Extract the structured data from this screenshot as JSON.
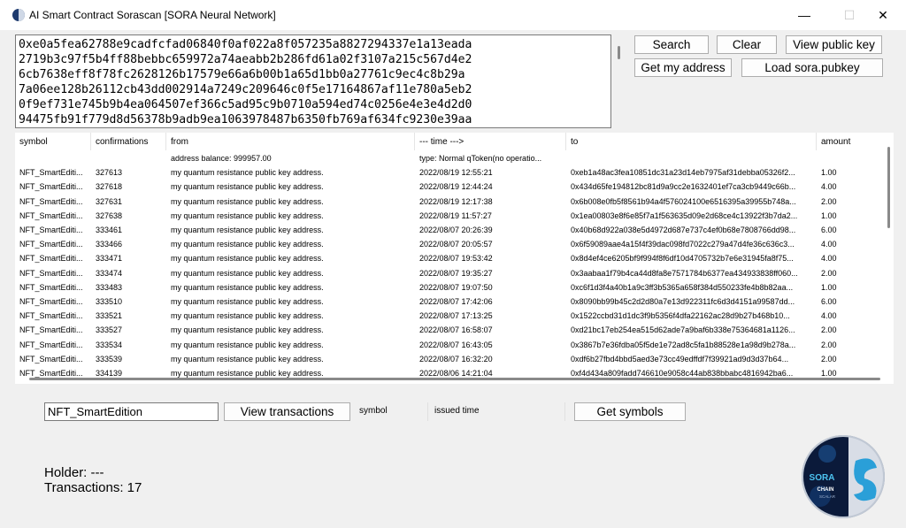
{
  "window": {
    "title": "AI Smart Contract Sorascan [SORA Neural Network]",
    "minimize": "—",
    "maximize": "☐",
    "close": "✕"
  },
  "address_text": "0xe0a5fea62788e9cadfcfad06840f0af022a8f057235a8827294337e1a13eada\n2719b3c97f5b4ff88bebbc659972a74aeabb2b286fd61a02f3107a215c567d4e2\n6cb7638eff8f78fc2628126b17579e66a6b00b1a65d1bb0a27761c9ec4c8b29a\n7a06ee128b26112cb43dd002914a7249c209646c0f5e17164867af11e780a5eb2\n0f9ef731e745b9b4ea064507ef366c5ad95c9b0710a594ed74c0256e4e3e4d2d0\n94475fb91f779d8d56378b9adb9ea1063978487b6350fb769af634fc9230e39aa",
  "buttons": {
    "search": "Search",
    "clear": "Clear",
    "view_public_key": "View public key",
    "get_my_address": "Get my address",
    "load_pubkey": "Load sora.pubkey",
    "view_transactions": "View transactions",
    "get_symbols": "Get symbols"
  },
  "table": {
    "columns": [
      "symbol",
      "confirmations",
      "from",
      "--- time --->",
      "to",
      "amount"
    ],
    "info_row": {
      "from": "address balance: 999957.00",
      "time": "type: Normal qToken(no operatio..."
    },
    "rows": [
      {
        "symbol": "NFT_SmartEditi...",
        "confirmations": "327613",
        "from": "my quantum resistance public key address.",
        "time": "2022/08/19 12:55:21",
        "to": "0xeb1a48ac3fea10851dc31a23d14eb7975af31debba05326f2...",
        "amount": "1.00"
      },
      {
        "symbol": "NFT_SmartEditi...",
        "confirmations": "327618",
        "from": "my quantum resistance public key address.",
        "time": "2022/08/19 12:44:24",
        "to": "0x434d65fe194812bc81d9a9cc2e1632401ef7ca3cb9449c66b...",
        "amount": "4.00"
      },
      {
        "symbol": "NFT_SmartEditi...",
        "confirmations": "327631",
        "from": "my quantum resistance public key address.",
        "time": "2022/08/19 12:17:38",
        "to": "0x6b008e0fb5f8561b94a4f576024100e6516395a39955b748a...",
        "amount": "2.00"
      },
      {
        "symbol": "NFT_SmartEditi...",
        "confirmations": "327638",
        "from": "my quantum resistance public key address.",
        "time": "2022/08/19 11:57:27",
        "to": "0x1ea00803e8f6e85f7a1f563635d09e2d68ce4c13922f3b7da2...",
        "amount": "1.00"
      },
      {
        "symbol": "NFT_SmartEditi...",
        "confirmations": "333461",
        "from": "my quantum resistance public key address.",
        "time": "2022/08/07 20:26:39",
        "to": "0x40b68d922a038e5d4972d687e737c4ef0b68e7808766dd98...",
        "amount": "6.00"
      },
      {
        "symbol": "NFT_SmartEditi...",
        "confirmations": "333466",
        "from": "my quantum resistance public key address.",
        "time": "2022/08/07 20:05:57",
        "to": "0x6f59089aae4a15f4f39dac098fd7022c279a47d4fe36c636c3...",
        "amount": "4.00"
      },
      {
        "symbol": "NFT_SmartEditi...",
        "confirmations": "333471",
        "from": "my quantum resistance public key address.",
        "time": "2022/08/07 19:53:42",
        "to": "0x8d4ef4ce6205bf9f994f8f6df10d4705732b7e6e31945fa8f75...",
        "amount": "4.00"
      },
      {
        "symbol": "NFT_SmartEditi...",
        "confirmations": "333474",
        "from": "my quantum resistance public key address.",
        "time": "2022/08/07 19:35:27",
        "to": "0x3aabaa1f79b4ca44d8fa8e7571784b6377ea434933838ff060...",
        "amount": "2.00"
      },
      {
        "symbol": "NFT_SmartEditi...",
        "confirmations": "333483",
        "from": "my quantum resistance public key address.",
        "time": "2022/08/07 19:07:50",
        "to": "0xc6f1d3f4a40b1a9c3ff3b5365a658f384d550233fe4b8b82aa...",
        "amount": "1.00"
      },
      {
        "symbol": "NFT_SmartEditi...",
        "confirmations": "333510",
        "from": "my quantum resistance public key address.",
        "time": "2022/08/07 17:42:06",
        "to": "0x8090bb99b45c2d2d80a7e13d922311fc6d3d4151a99587dd...",
        "amount": "6.00"
      },
      {
        "symbol": "NFT_SmartEditi...",
        "confirmations": "333521",
        "from": "my quantum resistance public key address.",
        "time": "2022/08/07 17:13:25",
        "to": "0x1522ccbd31d1dc3f9b5356f4dfa22162ac28d9b27b468b10...",
        "amount": "4.00"
      },
      {
        "symbol": "NFT_SmartEditi...",
        "confirmations": "333527",
        "from": "my quantum resistance public key address.",
        "time": "2022/08/07 16:58:07",
        "to": "0xd21bc17eb254ea515d62ade7a9baf6b338e75364681a1126...",
        "amount": "2.00"
      },
      {
        "symbol": "NFT_SmartEditi...",
        "confirmations": "333534",
        "from": "my quantum resistance public key address.",
        "time": "2022/08/07 16:43:05",
        "to": "0x3867b7e36fdba05f5de1e72ad8c5fa1b88528e1a98d9b278a...",
        "amount": "2.00"
      },
      {
        "symbol": "NFT_SmartEditi...",
        "confirmations": "333539",
        "from": "my quantum resistance public key address.",
        "time": "2022/08/07 16:32:20",
        "to": "0xdf6b27fbd4bbd5aed3e73cc49edffdf7f39921ad9d3d37b64...",
        "amount": "2.00"
      },
      {
        "symbol": "NFT_SmartEditi...",
        "confirmations": "334139",
        "from": "my quantum resistance public key address.",
        "time": "2022/08/06 14:21:04",
        "to": "0xf4d434a809fadd746610e9058c44ab838bbabc4816942ba6...",
        "amount": "1.00"
      }
    ]
  },
  "symbol_input_value": "NFT_SmartEdition",
  "symbol_label": "symbol",
  "issued_time_label": "issued time",
  "holder_text": "Holder: ---",
  "transactions_text": "Transactions: 17",
  "logo": {
    "text_top": "SORA",
    "text_mid": "CHAIN",
    "text_bottom": "SCALAR"
  },
  "colors": {
    "accent": "#1e3a6e",
    "logo_cyan": "#33b6e6"
  }
}
